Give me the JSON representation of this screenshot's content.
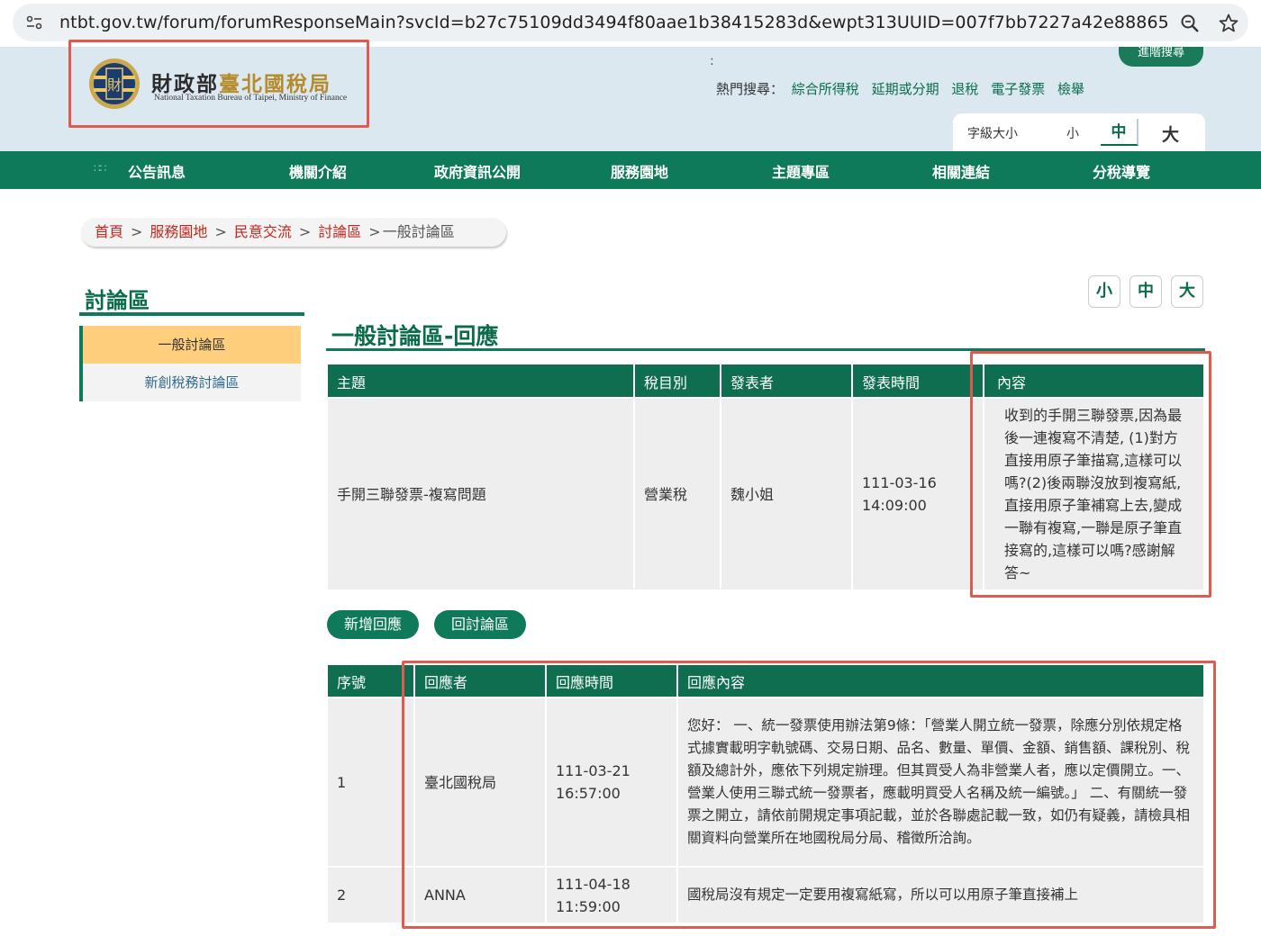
{
  "browser": {
    "url": "ntbt.gov.tw/forum/forumResponseMain?svcId=b27c75109dd3494f80aae1b38415283d&ewpt313UUID=007f7bb7227a42e88865799...",
    "tune_icon": "tune-icon",
    "zoom_icon": "zoom-icon",
    "bookmark_icon": "star-icon"
  },
  "header": {
    "logo_cn_prefix": "財政部",
    "logo_cn_suffix": "臺北國稅局",
    "logo_en": "National Taxation Bureau of Taipei, Ministry of Finance",
    "colon": ":",
    "advanced_search": "進階搜尋",
    "hot_label": "熱門搜尋：",
    "hot_links": [
      "綜合所得稅",
      "延期或分期",
      "退稅",
      "電子發票",
      "檢舉"
    ],
    "font_size_label": "字級大小",
    "font_small": "小",
    "font_medium": "中",
    "font_large": "大"
  },
  "nav": {
    "items": [
      "公告訊息",
      "機關介紹",
      "政府資訊公開",
      "服務園地",
      "主題專區",
      "相關連結",
      "分稅導覽"
    ]
  },
  "breadcrumb": {
    "home": "首頁",
    "l1": "服務園地",
    "l2": "民意交流",
    "l3": "討論區",
    "current": "一般討論區",
    "sep": ">"
  },
  "sidebar": {
    "title": "討論區",
    "items": [
      "一般討論區",
      "新創稅務討論區"
    ]
  },
  "font_buttons": [
    "小",
    "中",
    "大"
  ],
  "page_title": "一般討論區-回應",
  "topic_table": {
    "headers": [
      "主題",
      "稅目別",
      "發表者",
      "發表時間",
      "內容"
    ],
    "row": {
      "subject": "手開三聯發票-複寫問題",
      "tax_type": "營業稅",
      "author": "魏小姐",
      "date": "111-03-16",
      "time": "14:09:00",
      "content": "收到的手開三聯發票,因為最後一連複寫不清楚, (1)對方直接用原子筆描寫,這樣可以嗎?(2)後兩聯沒放到複寫紙,直接用原子筆補寫上去,變成一聯有複寫,一聯是原子筆直接寫的,這樣可以嗎?感謝解答~"
    }
  },
  "buttons": {
    "add_reply": "新增回應",
    "back": "回討論區"
  },
  "reply_table": {
    "headers": [
      "序號",
      "回應者",
      "回應時間",
      "回應內容"
    ],
    "rows": [
      {
        "no": "1",
        "responder": "臺北國稅局",
        "date": "111-03-21",
        "time": "16:57:00",
        "content": "您好： 一、統一發票使用辦法第9條：「營業人開立統一發票，除應分別依規定格式據實載明字軌號碼、交易日期、品名、數量、單價、金額、銷售額、課稅別、稅額及總計外，應依下列規定辦理。但其買受人為非營業人者，應以定價開立。一、營業人使用三聯式統一發票者，應載明買受人名稱及統一編號。」 二、有關統一發票之開立，請依前開規定事項記載，並於各聯處記載一致，如仍有疑義，請檢具相關資料向營業所在地國稅局分局、稽徵所洽詢。"
      },
      {
        "no": "2",
        "responder": "ANNA",
        "date": "111-04-18",
        "time": "11:59:00",
        "content": "國稅局沒有規定一定要用複寫紙寫，所以可以用原子筆直接補上"
      }
    ]
  },
  "colors": {
    "brand_green": "#0e7a5a",
    "header_bg": "#dbe8f0",
    "highlight_red": "#e05a4f",
    "active_side": "#ffcf7d",
    "crumb_link": "#c0281e"
  }
}
